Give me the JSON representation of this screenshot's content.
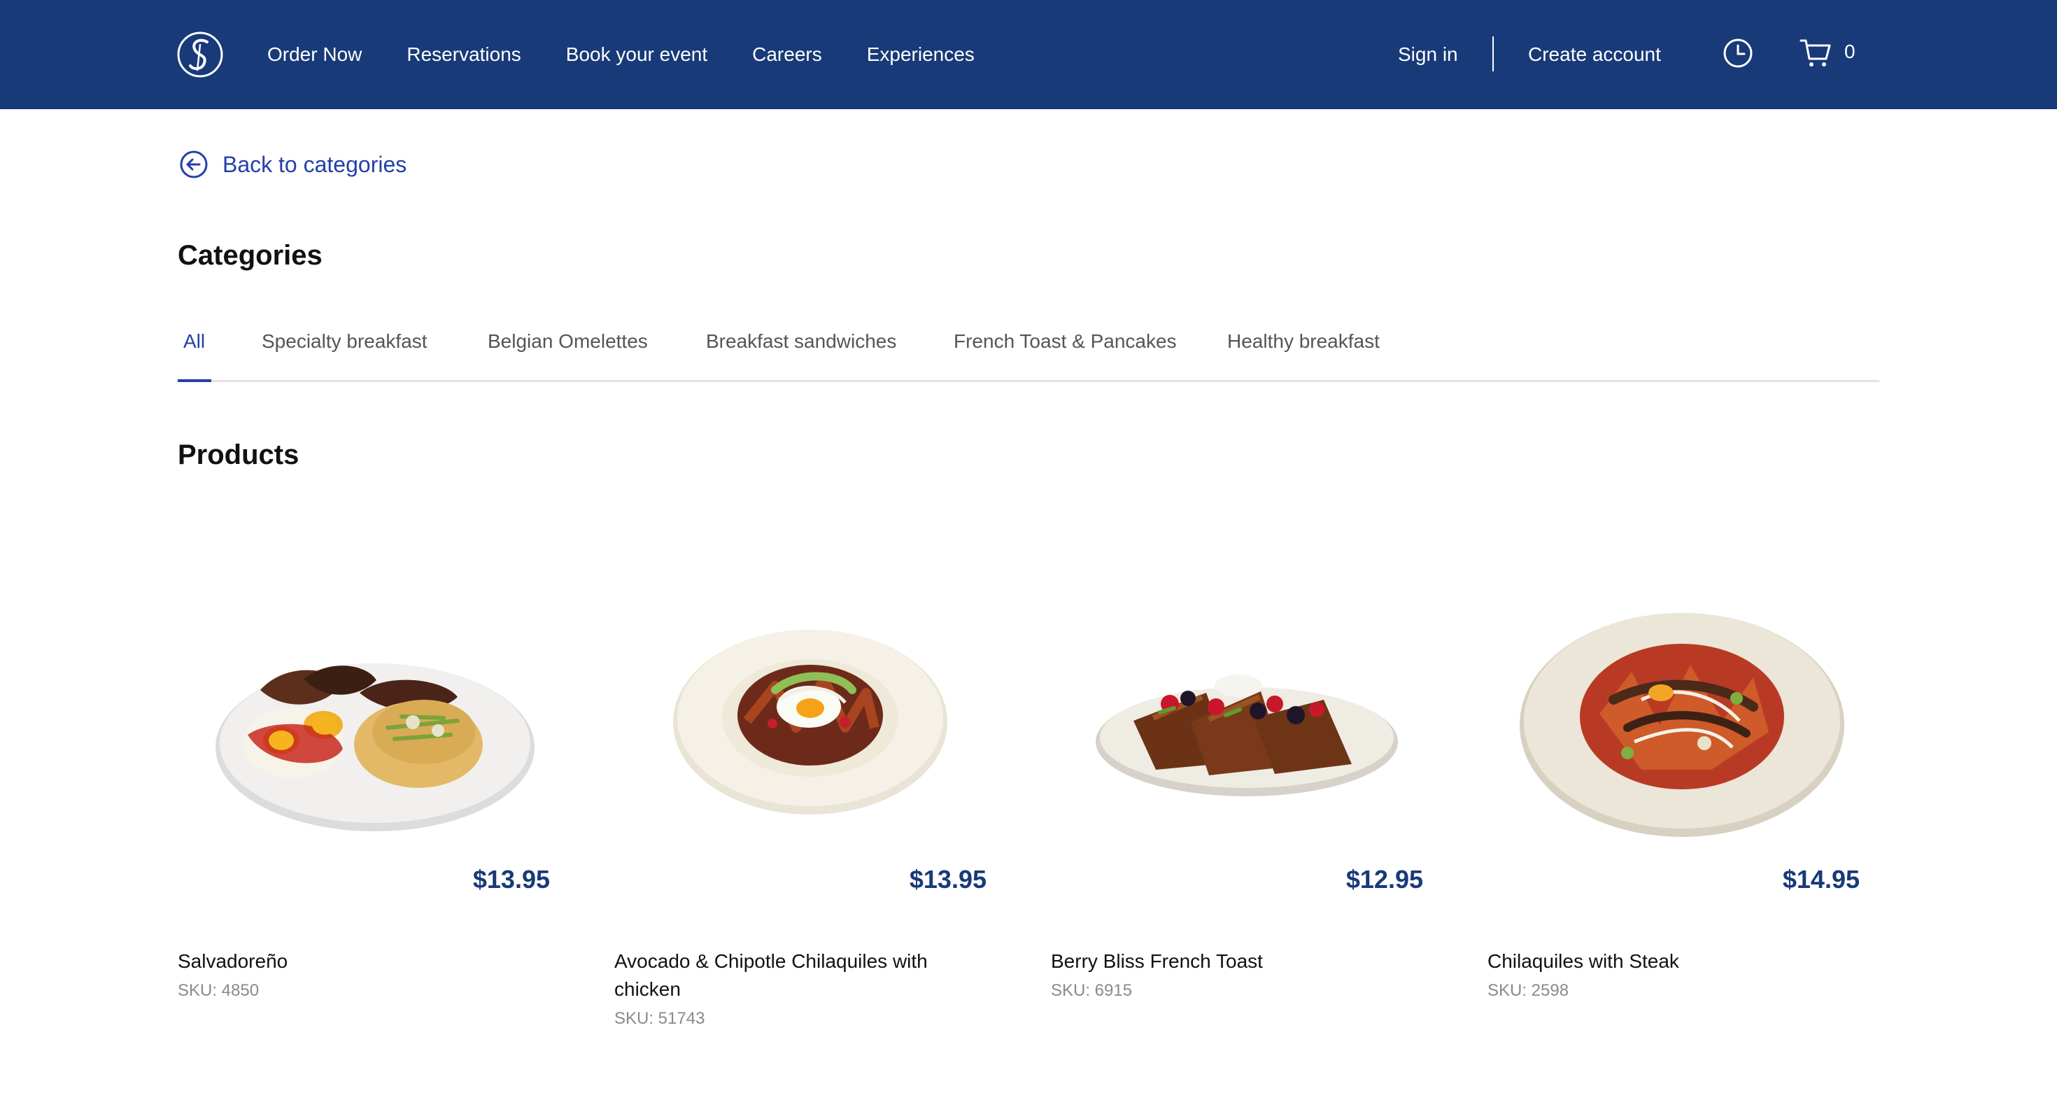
{
  "header": {
    "nav": [
      "Order Now",
      "Reservations",
      "Book your event",
      "Careers",
      "Experiences"
    ],
    "sign_in": "Sign in",
    "create_account": "Create account",
    "cart_count": "0",
    "brand_color": "#183a78"
  },
  "back_link": {
    "label": "Back to categories",
    "icon": "arrow-left-circle-icon"
  },
  "categories": {
    "title": "Categories",
    "tabs": [
      "All",
      "Specialty breakfast",
      "Belgian Omelettes",
      "Breakfast sandwiches",
      "French Toast & Pancakes",
      "Healthy breakfast"
    ],
    "active": "All"
  },
  "products": {
    "title": "Products",
    "items": [
      {
        "price": "$13.95",
        "name": "Salvadoreño",
        "sku": "SKU: 4850"
      },
      {
        "price": "$13.95",
        "name": "Avocado & Chipotle Chilaquiles with chicken",
        "sku": "SKU: 51743"
      },
      {
        "price": "$12.95",
        "name": "Berry Bliss French Toast",
        "sku": "SKU: 6915"
      },
      {
        "price": "$14.95",
        "name": "Chilaquiles with Steak",
        "sku": "SKU: 2598"
      }
    ]
  }
}
